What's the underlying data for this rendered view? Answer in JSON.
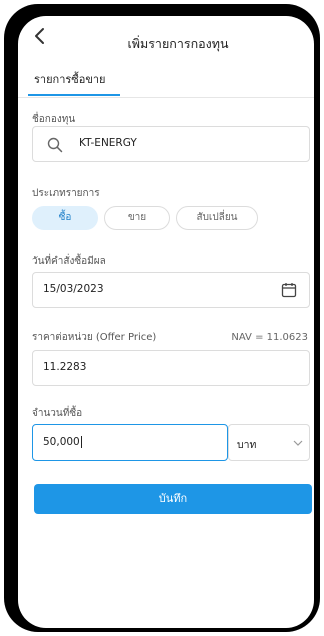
{
  "header": {
    "title": "เพิ่มรายการกองทุน"
  },
  "tabs": [
    {
      "label": "รายการซื้อขาย",
      "active": true
    }
  ],
  "fund": {
    "label": "ชื่อกองทุน",
    "value": "KT-ENERGY",
    "icon": "search-icon"
  },
  "transaction_type": {
    "label": "ประเภทรายการ",
    "options": [
      "ซื้อ",
      "ขาย",
      "สับเปลี่ยน"
    ],
    "selected": "ซื้อ"
  },
  "order_date": {
    "label": "วันที่คำสั่งซื้อมีผล",
    "value": "15/03/2023",
    "icon": "calendar-icon"
  },
  "price": {
    "label": "ราคาต่อหน่วย (Offer Price)",
    "nav_text": "NAV = 11.0623",
    "value": "11.2283"
  },
  "amount": {
    "label": "จำนวนที่ซื้อ",
    "value": "50,000",
    "unit": "บาท"
  },
  "save_label": "บันทึก",
  "colors": {
    "accent": "#1e96e6",
    "active_pill_bg": "#dff0fc",
    "frame": "#000000"
  }
}
